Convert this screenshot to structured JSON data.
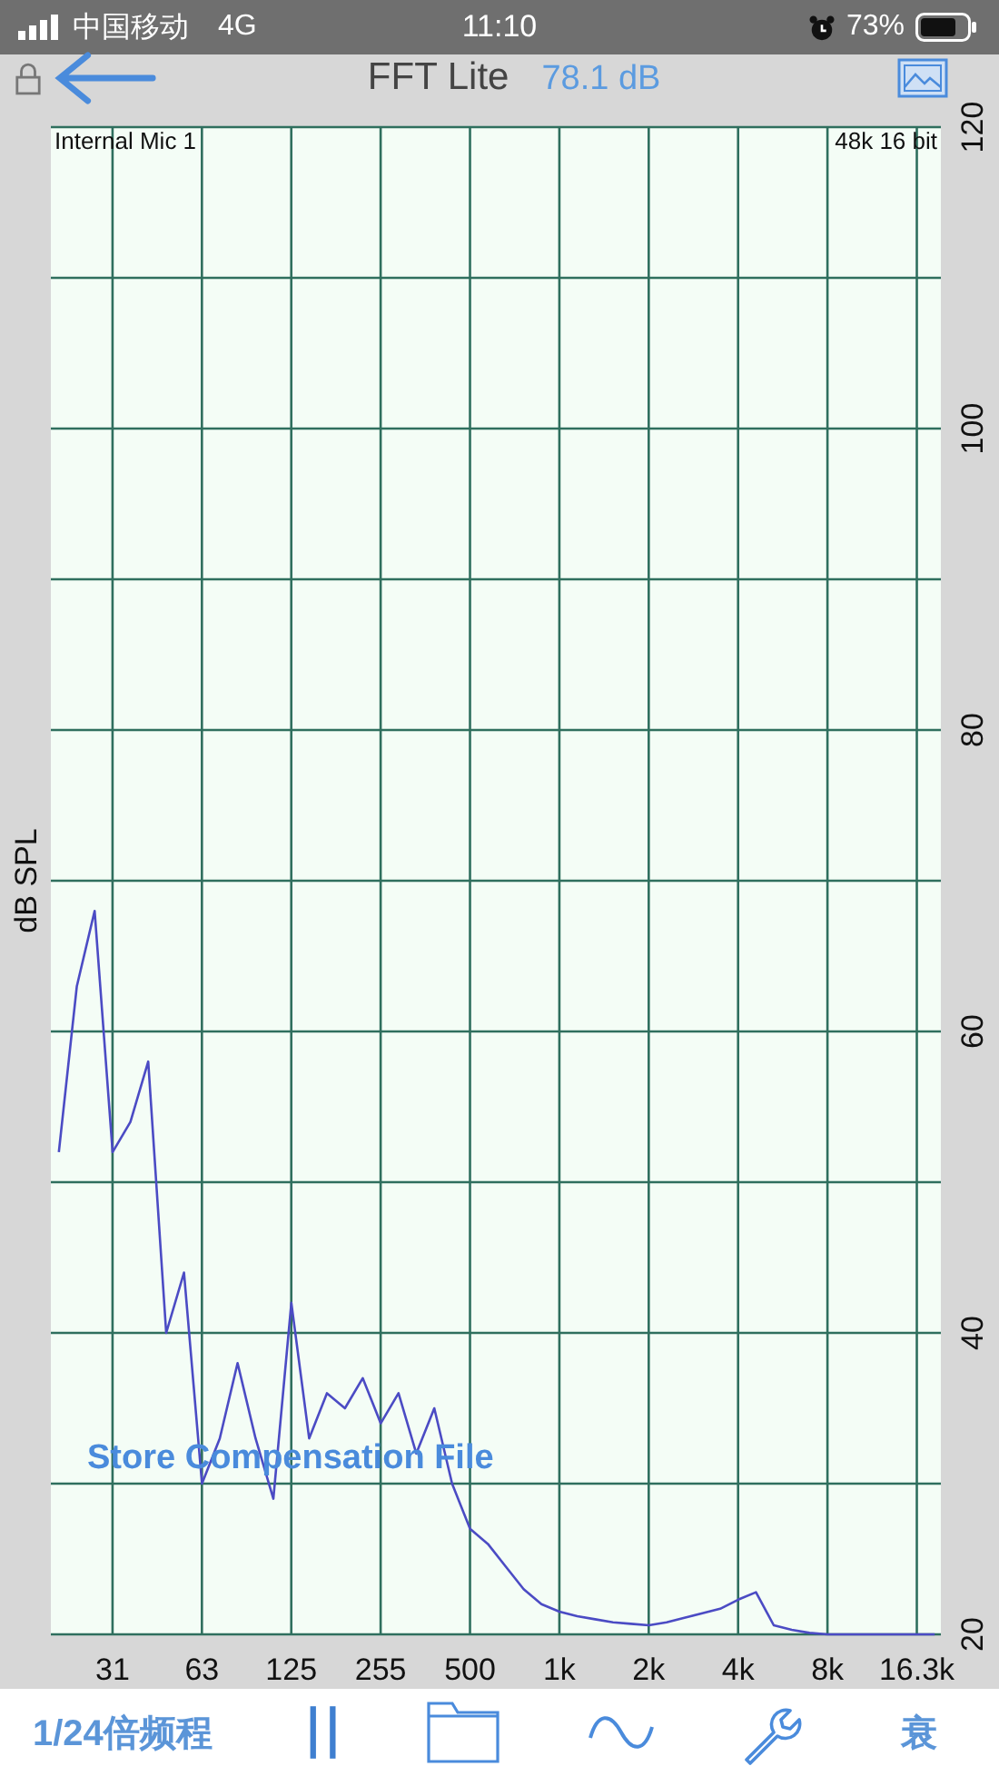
{
  "status_bar": {
    "carrier": "中国移动",
    "network": "4G",
    "time": "11:10",
    "battery": "73%"
  },
  "nav_bar": {
    "title": "FFT Lite",
    "reading": "78.1 dB"
  },
  "chart": {
    "input": "Internal Mic 1",
    "format": "48k 16 bit",
    "overlay_action": "Store Compensation File",
    "chart_data": {
      "type": "line",
      "ylabel": "dB SPL",
      "grid": true,
      "ylim": [
        20,
        120
      ],
      "categories": [
        null,
        null,
        null,
        null,
        "31",
        null,
        null,
        null,
        null,
        "63",
        null,
        null,
        null,
        null,
        "125",
        null,
        null,
        null,
        null,
        "255",
        null,
        null,
        null,
        null,
        "500",
        null,
        null,
        null,
        null,
        "1k",
        null,
        null,
        null,
        null,
        "2k",
        null,
        null,
        null,
        null,
        "4k",
        null,
        null,
        null,
        null,
        "8k",
        null,
        null,
        null,
        null,
        "16.3k",
        null
      ],
      "yticks": [
        20,
        40,
        60,
        80,
        100,
        120
      ],
      "series": [
        {
          "color": "#4b4bc4",
          "values": [
            null,
            52,
            63,
            68,
            52,
            54,
            58,
            40,
            44,
            30,
            33,
            38,
            33,
            29,
            42,
            33,
            36,
            35,
            37,
            34,
            36,
            32,
            35,
            30,
            27,
            26,
            24.5,
            23,
            22,
            21.5,
            21.2,
            21,
            20.8,
            20.7,
            20.6,
            20.8,
            21.1,
            21.4,
            21.7,
            22.3,
            22.8,
            20.6,
            20.3,
            20.1,
            20,
            20,
            20,
            20,
            20,
            20,
            20
          ]
        }
      ]
    }
  },
  "toolbar": {
    "resolution": "1/24倍频程",
    "last_label": "衰"
  }
}
